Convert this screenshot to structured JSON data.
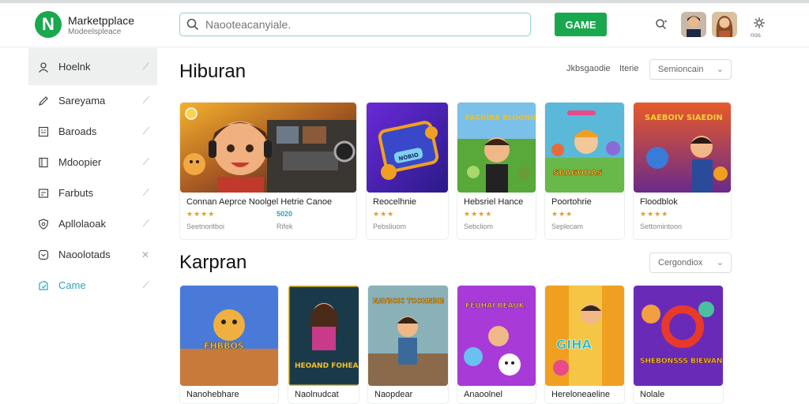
{
  "header": {
    "logo_letter": "N",
    "brand": "Marketpplace",
    "brand_sub": "Modeelspleace",
    "search_placeholder": "Naooteacanyiale.",
    "game_button": "GAME",
    "notif_small": "nos"
  },
  "sidebar": {
    "items": [
      {
        "label": "Hoelnk",
        "icon": "user-icon",
        "active": true
      },
      {
        "label": "Sareyama",
        "icon": "pencil-icon"
      },
      {
        "label": "Baroads",
        "icon": "calendar-icon"
      },
      {
        "label": "Mdoopier",
        "icon": "book-icon"
      },
      {
        "label": "Farbuts",
        "icon": "tray-icon"
      },
      {
        "label": "Apllolaoak",
        "icon": "shield-icon"
      },
      {
        "label": "Naoolotads",
        "icon": "chat-icon"
      },
      {
        "label": "Came",
        "icon": "game-icon",
        "highlight": true
      }
    ]
  },
  "section1": {
    "title": "Hiburan",
    "filter_a": "Jkbsgaodie",
    "filter_b": "Iterie",
    "dropdown": "Semioncain",
    "cards": [
      {
        "title": "Connan Aeprce Noolgel Hetrie Canoe",
        "stars": "★★★★",
        "meta": "Seetnoritboi",
        "badge": "5020",
        "badge_sub": "Rifek"
      },
      {
        "title": "Reocelhnie",
        "stars": "★★★",
        "meta": "Pebsliuom",
        "thumb_text": "NOBIO"
      },
      {
        "title": "Hebsriel Hance",
        "stars": "★★★★",
        "meta": "Sebcliom",
        "thumb_text": "FAGUIBA BLOONIR"
      },
      {
        "title": "Poortohrie",
        "stars": "★★★",
        "meta": "Seplecam",
        "thumb_text": "SBAGODAS"
      },
      {
        "title": "Floodblok",
        "stars": "★★★★",
        "meta": "Settomintoon",
        "thumb_text": "SAEBOIV SIAEDIN"
      }
    ]
  },
  "section2": {
    "title": "Karpran",
    "dropdown": "Cergondiox",
    "cards": [
      {
        "title": "Nanohebhare",
        "thumb_text": "FHBBOS"
      },
      {
        "title": "Naolnudcat",
        "thumb_text": "HEOAND FOHEAI"
      },
      {
        "title": "Naopdear",
        "thumb_text": "NAVBOIC TOOHNBIE"
      },
      {
        "title": "Anaoolnel",
        "thumb_text": "FEUHAI BEAUK"
      },
      {
        "title": "Hereloneaeline",
        "thumb_text": "GIHA"
      },
      {
        "title": "Nolale",
        "thumb_text": "SHEBONSSS BIEWANA"
      }
    ]
  },
  "colors": {
    "brand_green": "#1aa84e",
    "accent_teal": "#2aa6b8",
    "star": "#e3a21a"
  }
}
